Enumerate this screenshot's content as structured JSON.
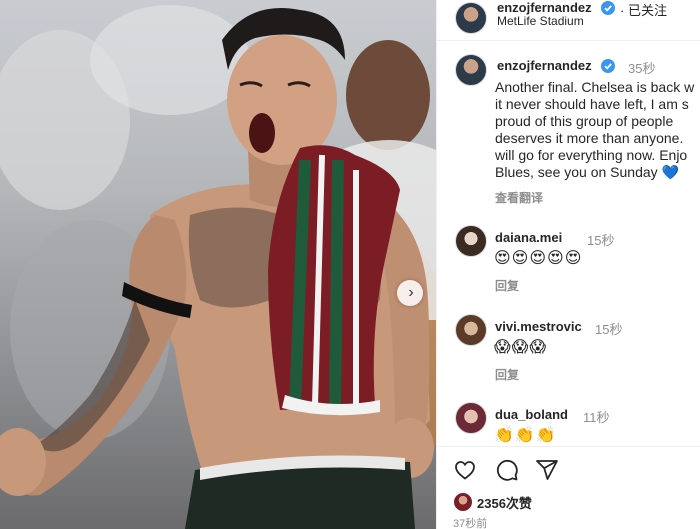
{
  "post": {
    "image_alt": "Enzo Fernandez celebrating with Fluminense shirt"
  },
  "header": {
    "username": "enzojfernandez",
    "follow_status": "· 已关注",
    "location": "MetLife Stadium"
  },
  "caption": {
    "username": "enzojfernandez",
    "time": "35秒",
    "lines": [
      "Another final. Chelsea is back w",
      "it never should have left, I am s",
      "proud of this group of people",
      "deserves it more than anyone.",
      "will go for everything now. Enjo",
      "Blues, see you on Sunday"
    ],
    "end_emoji": "💙",
    "translate": "查看翻译"
  },
  "comments": [
    {
      "username": "daiana.mei",
      "time": "15秒",
      "emojis": "😍😍😍😍😍",
      "reply": "回复"
    },
    {
      "username": "vivi.mestrovic",
      "time": "15秒",
      "emojis": "😱😱😱",
      "reply": "回复"
    },
    {
      "username": "dua_boland",
      "time": "11秒",
      "emojis": "👏👏👏",
      "reply": ""
    }
  ],
  "actions": {
    "icons": [
      "heart-icon",
      "comment-icon",
      "share-icon"
    ],
    "likes": "2356次赞",
    "time_ago": "37秒前"
  },
  "colors": {
    "verified": "#3897f0",
    "secondary_text": "#8e8e8e",
    "text": "#262626",
    "blue_heart": "#1e5fcf"
  }
}
